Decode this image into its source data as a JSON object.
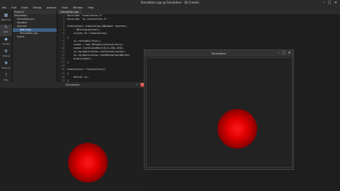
{
  "window": {
    "title": "Simulation.cpp @ Simulation - Qt Creator",
    "minimize": "–",
    "maximize": "□",
    "close": "×"
  },
  "menu": [
    "File",
    "Edit",
    "Build",
    "Debug",
    "Analyze",
    "Tools",
    "Window",
    "Help"
  ],
  "modes": [
    {
      "icon": "▦",
      "label": "Welcome"
    },
    {
      "icon": "✎",
      "label": "Edit"
    },
    {
      "icon": "◆",
      "label": "Design"
    },
    {
      "icon": "⚙",
      "label": "Debug"
    },
    {
      "icon": "✚",
      "label": "Projects"
    },
    {
      "icon": "?",
      "label": "Help"
    }
  ],
  "projects": {
    "header": "Projects",
    "items": [
      "Simulation",
      "Simulation.pro",
      "Headers",
      "Sources",
      "main.cpp",
      "Simulation.cpp",
      "Forms"
    ]
  },
  "editor": {
    "tab": "simulation.cpp",
    "line_numbers": [
      "1",
      "2",
      "3",
      "4",
      "5",
      "6",
      "7",
      "8",
      "9",
      "10",
      "11",
      "12",
      "13",
      "14",
      "15",
      "16",
      "17",
      "18",
      "19",
      "20"
    ],
    "code": [
      "#include \"simulation.h\"",
      "#include \"ui_simulation.h\"",
      "",
      "Simulation::Simulation(QWidget *parent)",
      "    : QDialog(parent),",
      "    ui(new Ui::Simulation)",
      "{",
      "    ui->setupUi(this);",
      "    scene = new QGraphicsScene(this);",
      "    scene->setSceneRect(0,0,250,250);",
      "    ui->graphicsView->setScene(scene);",
      "    ui->graphicsView->setBackgroundBrush(",
      "    draw(scene);",
      "}",
      "",
      "Simulation::~Simulation()",
      "{",
      "    delete ui;",
      "}",
      ""
    ]
  },
  "sim_window_1": {
    "title": "Simulation",
    "close": "×",
    "minimize": "–"
  },
  "sim_window_2": {
    "title": "Simulation",
    "minimize": "–",
    "maximize": "□",
    "close": "×"
  },
  "colors": {
    "ball": "#e00000",
    "accent_selection": "#3f5f86"
  }
}
